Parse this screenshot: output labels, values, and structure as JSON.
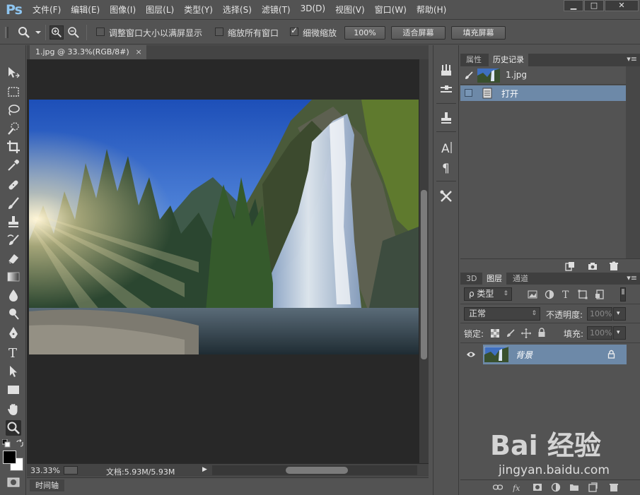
{
  "app": {
    "logo": "Ps"
  },
  "menu": [
    "文件(F)",
    "编辑(E)",
    "图像(I)",
    "图层(L)",
    "类型(Y)",
    "选择(S)",
    "滤镜(T)",
    "3D(D)",
    "视图(V)",
    "窗口(W)",
    "帮助(H)"
  ],
  "window_controls": {
    "minimize": "▁",
    "maximize": "□",
    "close": "✕"
  },
  "options": {
    "resize_windows_label": "调整窗口大小以满屏显示",
    "resize_windows_checked": false,
    "zoom_all_label": "缩放所有窗口",
    "zoom_all_checked": false,
    "scrubby_zoom_label": "细微缩放",
    "scrubby_zoom_checked": true,
    "btn_100": "100%",
    "btn_fit": "适合屏幕",
    "btn_fill": "填充屏幕"
  },
  "document": {
    "tab_title": "1.jpg @ 33.3%(RGB/8#)",
    "tab_close": "×",
    "zoom": "33.33%",
    "doc_size": "文档:5.93M/5.93M",
    "status_arrow": "▶"
  },
  "timeline": {
    "label": "时间轴"
  },
  "history_panel": {
    "tabs": [
      "属性",
      "历史记录"
    ],
    "active_tab": "历史记录",
    "snapshot_name": "1.jpg",
    "states": [
      "打开"
    ]
  },
  "layers_panel": {
    "tabs": [
      "3D",
      "图层",
      "通道"
    ],
    "active_tab": "图层",
    "filter_label": "ρ 类型",
    "blend_mode": "正常",
    "opacity_label": "不透明度:",
    "opacity_value": "100%",
    "lock_label": "锁定:",
    "fill_label": "填充:",
    "fill_value": "100%",
    "layers": [
      {
        "name": "背景",
        "visible": true,
        "locked": true
      }
    ]
  },
  "watermark": {
    "logo": "Bai 经验",
    "url": "jingyan.baidu.com"
  },
  "colors": {
    "accent_selection": "#6d89a8",
    "panel_bg": "#535353",
    "canvas_bg": "#282828"
  }
}
